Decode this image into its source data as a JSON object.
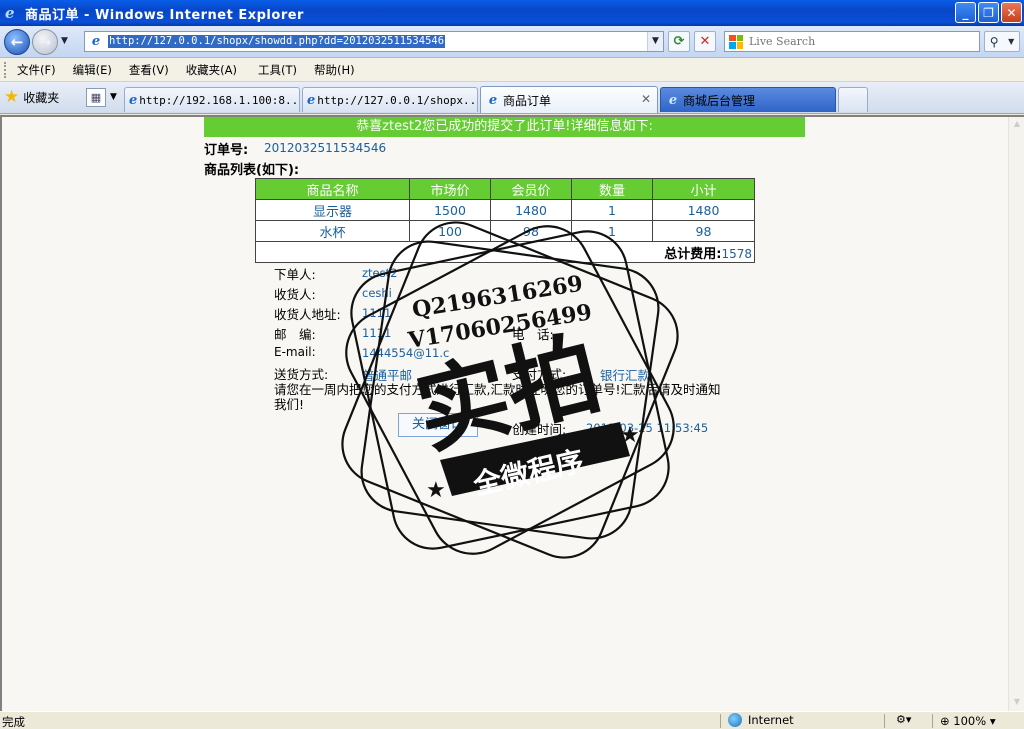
{
  "window": {
    "title": "商品订单 - Windows Internet Explorer",
    "minimize": "_",
    "restore": "❐",
    "close": "✕"
  },
  "address": {
    "url": "http://127.0.0.1/shopx/showdd.php?dd=2012032511534546",
    "search_placeholder": "Live Search"
  },
  "menu": [
    "文件(F)",
    "编辑(E)",
    "查看(V)",
    "收藏夹(A)",
    "工具(T)",
    "帮助(H)"
  ],
  "favorites_label": "收藏夹",
  "tabs": [
    {
      "label": "http://192.168.1.100:8..."
    },
    {
      "label": "http://127.0.0.1/shopx..."
    },
    {
      "label": "商品订单"
    },
    {
      "label": "商城后台管理"
    }
  ],
  "page": {
    "banner": "恭喜ztest2您已成功的提交了此订单!详细信息如下:",
    "order_no_label": "订单号:",
    "order_no": "2012032511534546",
    "list_title": "商品列表(如下):",
    "table": {
      "headers": [
        "商品名称",
        "市场价",
        "会员价",
        "数量",
        "小计"
      ],
      "rows": [
        [
          "显示器",
          "1500",
          "1480",
          "1",
          "1480"
        ],
        [
          "水杯",
          "100",
          "98",
          "1",
          "98"
        ]
      ],
      "total_label": "总计费用:",
      "total_value": "1578"
    },
    "orderer_label": "下单人:",
    "orderer": "ztest2",
    "receiver_label": "收货人:",
    "receiver": "ceshi",
    "address_label": "收货人地址:",
    "address": "1111",
    "postcode_label": "邮　编:",
    "postcode": "1111",
    "phone_label": "电　话:",
    "email_label": "E-mail:",
    "email": "1444554@11.c",
    "shipping_label": "送货方式:",
    "shipping": "普通平邮",
    "payment_label": "支付方式:",
    "payment": "银行汇款",
    "notice": "请您在一周内把您的支付方式进行汇款,汇款时注明您的订单号!汇款后请及时通知我们!",
    "close_button": "关闭窗口",
    "created_label": "创建时间:",
    "created": "2012-03-25 11:53:45"
  },
  "watermark": {
    "line1": "Q2196316269",
    "line2": "V17060256499",
    "big": "实拍",
    "ribbon": "全微程序"
  },
  "status": {
    "text": "完成",
    "zone": "Internet",
    "zoom": "100%"
  }
}
